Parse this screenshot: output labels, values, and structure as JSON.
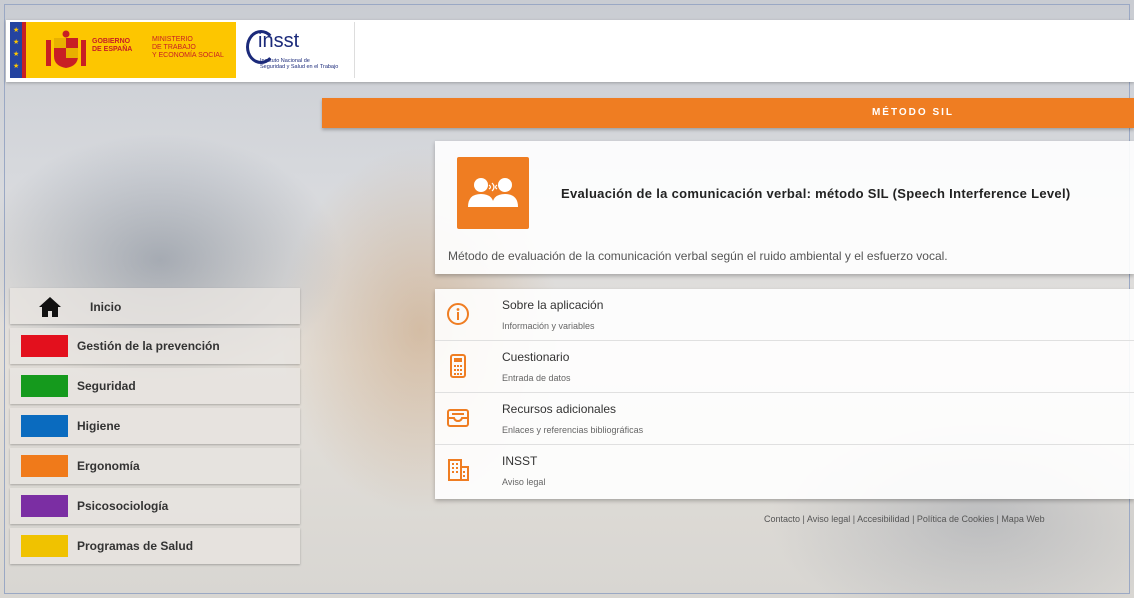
{
  "header": {
    "gov_line1": "GOBIERNO",
    "gov_line2": "DE ESPAÑA",
    "ministry_line1": "MINISTERIO",
    "ministry_line2": "DE TRABAJO",
    "ministry_line3": "Y ECONOMÍA SOCIAL",
    "logo_name": "insst",
    "logo_sub1": "Instituto Nacional de",
    "logo_sub2": "Seguridad y Salud en el Trabajo"
  },
  "banner": {
    "title": "MÉTODO SIL"
  },
  "hero": {
    "icon": "two-people-talking-icon",
    "title": "Evaluación de la comunicación verbal: método SIL (Speech Interference Level)",
    "description": "Método de evaluación de la comunicación verbal según el ruido ambiental y el esfuerzo vocal."
  },
  "menu": [
    {
      "icon": "info-icon",
      "title": "Sobre la aplicación",
      "subtitle": "Información y variables"
    },
    {
      "icon": "calculator-icon",
      "title": "Cuestionario",
      "subtitle": "Entrada de datos"
    },
    {
      "icon": "inbox-icon",
      "title": "Recursos adicionales",
      "subtitle": "Enlaces y referencias bibliográficas"
    },
    {
      "icon": "building-icon",
      "title": "INSST",
      "subtitle": "Aviso legal"
    }
  ],
  "footer": {
    "links": "Contacto | Aviso legal | Accesibilidad | Política de Cookies | Mapa Web"
  },
  "sidebar": {
    "items": [
      {
        "label": "Inicio",
        "icon": "home-icon"
      },
      {
        "label": "Gestión de la prevención",
        "color": "#e3101d"
      },
      {
        "label": "Seguridad",
        "color": "#159a1d"
      },
      {
        "label": "Higiene",
        "color": "#0a6bbf"
      },
      {
        "label": "Ergonomía",
        "color": "#f07a1a"
      },
      {
        "label": "Psicosociología",
        "color": "#7b2ea3"
      },
      {
        "label": "Programas de Salud",
        "color": "#f0c200"
      }
    ]
  },
  "colors": {
    "accent": "#ef7d22",
    "brand_blue": "#1b2a7a",
    "gov_yellow": "#fdc600"
  }
}
